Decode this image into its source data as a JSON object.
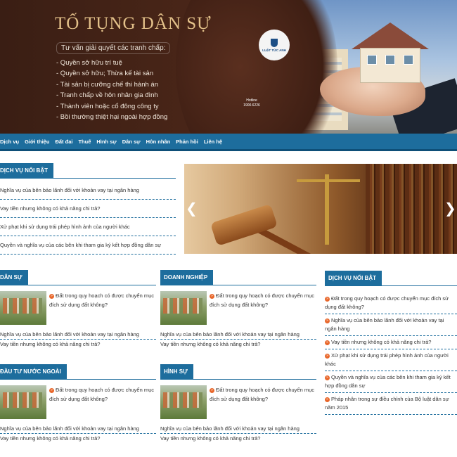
{
  "banner": {
    "title": "TỐ TỤNG DÂN SỰ",
    "subtitle": "Tư vấn giải quyết các tranh chấp:",
    "features": [
      "- Quyền sở hữu trí tuệ",
      "- Quyền sở hữu; Thừa kế tài sản",
      "- Tài sản bị cưỡng chế thi hành án",
      "- Tranh chấp về hôn nhân gia đình",
      "- Thành viên hoặc cổ đông công ty",
      "- Bồi thường thiệt hại ngoài hợp đồng"
    ],
    "logo_text": "LUẬT TỨC ANH",
    "hotline_label": "Hotline",
    "hotline_number": "1900.6226"
  },
  "nav": {
    "items": [
      "Dịch vụ",
      "Giới thiệu",
      "Đất đai",
      "Thuế",
      "Hình sự",
      "Dân sự",
      "Hôn nhân",
      "Phản hồi",
      "Liên hệ"
    ]
  },
  "featured": {
    "heading": "DỊCH VỤ NỔI BẬT",
    "items": [
      "Nghĩa vụ của bên bảo lãnh đối với khoản vay tại ngân hàng",
      "Vay tiền nhưng không có khả năng chi trả?",
      "Xử phạt khi sử dụng trái phép hình ảnh của người khác",
      "Quyền và nghĩa vụ của các bên khi tham gia ký kết hợp đồng dân sự"
    ]
  },
  "slider": {
    "prev_symbol": "❮",
    "next_symbol": "❯"
  },
  "categories": [
    {
      "heading": "DÂN SỰ",
      "lead": "Đất trong quy hoạch có được chuyển mục đích sử dụng đất không?",
      "items": [
        "Nghĩa vụ của bên bảo lãnh đối với khoản vay tại ngân hàng",
        "Vay tiền nhưng không có khả năng chi trả?"
      ]
    },
    {
      "heading": "DOANH NGHIỆP",
      "lead": "Đất trong quy hoạch có được chuyển mục đích sử dụng đất không?",
      "items": [
        "Nghĩa vụ của bên bảo lãnh đối với khoản vay tại ngân hàng",
        "Vay tiền nhưng không có khả năng chi trả?"
      ]
    },
    {
      "heading": "ĐẦU TƯ NƯỚC NGOÀI",
      "lead": "Đất trong quy hoạch có được chuyển mục đích sử dụng đất không?",
      "items": [
        "Nghĩa vụ của bên bảo lãnh đối với khoản vay tại ngân hàng",
        "Vay tiền nhưng không có khả năng chi trả?"
      ]
    },
    {
      "heading": "HÌNH SỰ",
      "lead": "Đất trong quy hoạch có được chuyển mục đích sử dụng đất không?",
      "items": [
        "Nghĩa vụ của bên bảo lãnh đối với khoản vay tại ngân hàng",
        "Vay tiền nhưng không có khả năng chi trả?"
      ]
    }
  ],
  "sidebar": {
    "heading": "DỊCH VỤ NỔI BẬT",
    "items": [
      "Đất trong quy hoạch có được chuyển mục đích sử dụng đất không?",
      "Nghĩa vụ của bên bảo lãnh đối với khoản vay tại ngân hàng",
      "Vay tiền nhưng không có khả năng chi trả?",
      "Xử phạt khi sử dụng trái phép hình ảnh của người khác",
      "Quyền và nghĩa vụ của các bên khi tham gia ký kết hợp đồng dân sự",
      "Pháp nhân trong sự điều chỉnh của Bộ luật dân sự năm 2015"
    ]
  },
  "theme": {
    "primary": "#1d6d9d",
    "bullet": "#e8672b",
    "banner_title": "#e3c18a"
  }
}
